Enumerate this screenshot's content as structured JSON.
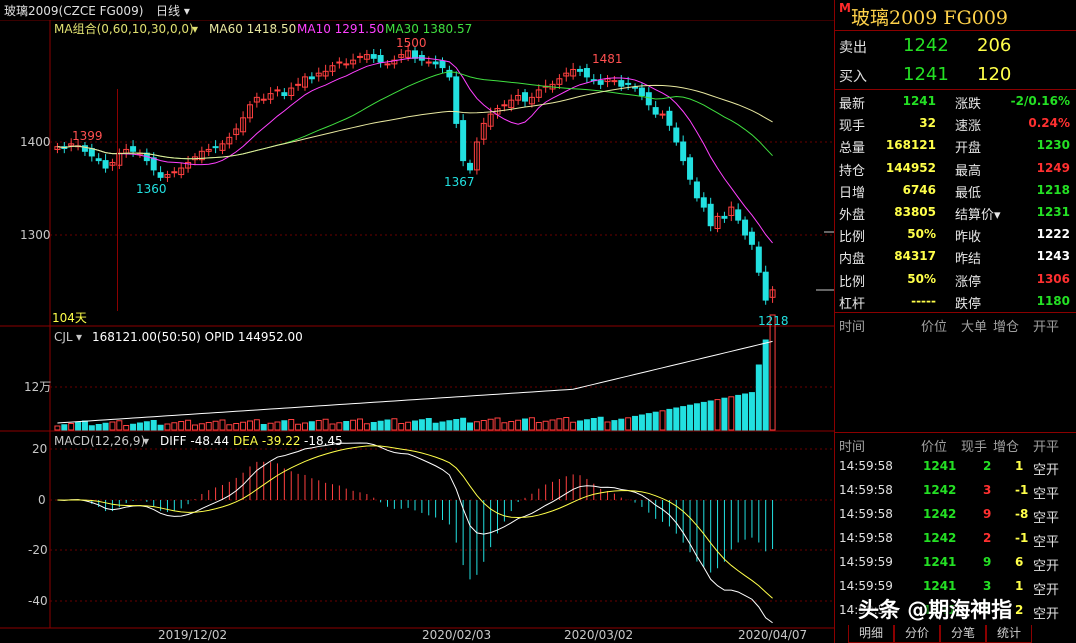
{
  "header": {
    "symbol": "玻璃2009(CZCE FG009)",
    "period": "日线"
  },
  "legend": {
    "ma_combo": "MA组合(0,60,10,30,0,0)",
    "ma60": "MA60 1418.50",
    "ma10": "MA10 1291.50",
    "ma30": "MA30 1380.57"
  },
  "price_axis": {
    "t1400": "1400",
    "t1300": "1300"
  },
  "annotations": {
    "a1500": "1500",
    "a1481": "1481",
    "a1399": "1399",
    "a1360": "1360",
    "a1367": "1367",
    "a1218": "1218",
    "days": "104天"
  },
  "volume_panel": {
    "label": "CJL",
    "values": "168121.00(50:50)  OPID 144952.00",
    "axis": "12万"
  },
  "macd_panel": {
    "label": "MACD(12,26,9)",
    "diff": "DIFF -48.44",
    "dea": "DEA -39.22",
    "macd": "-18.45",
    "ticks": [
      "20",
      "0",
      "-20",
      "-40"
    ]
  },
  "dates": [
    "2019/12/02",
    "2020/02/03",
    "2020/03/02",
    "2020/04/07"
  ],
  "colors": {
    "up": "#ff4040",
    "down": "#22e0e0",
    "ma60": "#e8e8a0",
    "ma10": "#ff40ff",
    "ma30": "#40e040"
  },
  "quote": {
    "mark": "M",
    "title": "玻璃2009  FG009",
    "sell_label": "卖出",
    "sell_price": "1242",
    "sell_vol": "206",
    "buy_label": "买入",
    "buy_price": "1241",
    "buy_vol": "120",
    "rows": [
      {
        "k1": "最新",
        "v1": "1241",
        "c1": "#24e024",
        "k2": "涨跌",
        "v2": "-2/0.16%",
        "c2": "#24e024"
      },
      {
        "k1": "现手",
        "v1": "32",
        "c1": "#ffff4a",
        "k2": "速涨",
        "v2": "0.24%",
        "c2": "#ff3030"
      },
      {
        "k1": "总量",
        "v1": "168121",
        "c1": "#ffff4a",
        "k2": "开盘",
        "v2": "1230",
        "c2": "#24e024"
      },
      {
        "k1": "持仓",
        "v1": "144952",
        "c1": "#ffff4a",
        "k2": "最高",
        "v2": "1249",
        "c2": "#ff3030"
      },
      {
        "k1": "日增",
        "v1": "6746",
        "c1": "#ffff4a",
        "k2": "最低",
        "v2": "1218",
        "c2": "#24e024"
      },
      {
        "k1": "外盘",
        "v1": "83805",
        "c1": "#ffff4a",
        "k2": "结算价▾",
        "v2": "1231",
        "c2": "#24e024"
      },
      {
        "k1": "比例",
        "v1": "50%",
        "c1": "#ffff4a",
        "k2": "昨收",
        "v2": "1222",
        "c2": "#ffffff"
      },
      {
        "k1": "内盘",
        "v1": "84317",
        "c1": "#ffff4a",
        "k2": "昨结",
        "v2": "1243",
        "c2": "#ffffff"
      },
      {
        "k1": "比例",
        "v1": "50%",
        "c1": "#ffff4a",
        "k2": "涨停",
        "v2": "1306",
        "c2": "#ff3030"
      },
      {
        "k1": "杠杆",
        "v1": "-----",
        "c1": "#ffff4a",
        "k2": "跌停",
        "v2": "1180",
        "c2": "#24e024"
      }
    ]
  },
  "detail_header": [
    "时间",
    "价位",
    "大单",
    "增仓",
    "开平"
  ],
  "trades_header": [
    "时间",
    "价位",
    "现手",
    "增仓",
    "开平"
  ],
  "trades": [
    {
      "t": "14:59:58",
      "p": "1241",
      "pc": "#24e024",
      "v": "2",
      "vc": "#24e024",
      "o": "1",
      "oc": "#ffff4a",
      "k": "空开"
    },
    {
      "t": "14:59:58",
      "p": "1242",
      "pc": "#24e024",
      "v": "3",
      "vc": "#ff3030",
      "o": "-1",
      "oc": "#ffff4a",
      "k": "空平"
    },
    {
      "t": "14:59:58",
      "p": "1242",
      "pc": "#24e024",
      "v": "9",
      "vc": "#ff3030",
      "o": "-8",
      "oc": "#ffff4a",
      "k": "空平"
    },
    {
      "t": "14:59:58",
      "p": "1242",
      "pc": "#24e024",
      "v": "2",
      "vc": "#ff3030",
      "o": "-1",
      "oc": "#ffff4a",
      "k": "空平"
    },
    {
      "t": "14:59:59",
      "p": "1241",
      "pc": "#24e024",
      "v": "9",
      "vc": "#24e024",
      "o": "6",
      "oc": "#ffff4a",
      "k": "空开"
    },
    {
      "t": "14:59:59",
      "p": "1241",
      "pc": "#24e024",
      "v": "3",
      "vc": "#24e024",
      "o": "1",
      "oc": "#ffff4a",
      "k": "空开"
    },
    {
      "t": "14:59:59",
      "p": "1241",
      "pc": "#24e024",
      "v": "2",
      "vc": "#24e024",
      "o": "2",
      "oc": "#ffff4a",
      "k": "空开"
    }
  ],
  "tabs": [
    "明细",
    "分价",
    "分笔",
    "统计"
  ],
  "watermark": "头条 @期海神指"
}
